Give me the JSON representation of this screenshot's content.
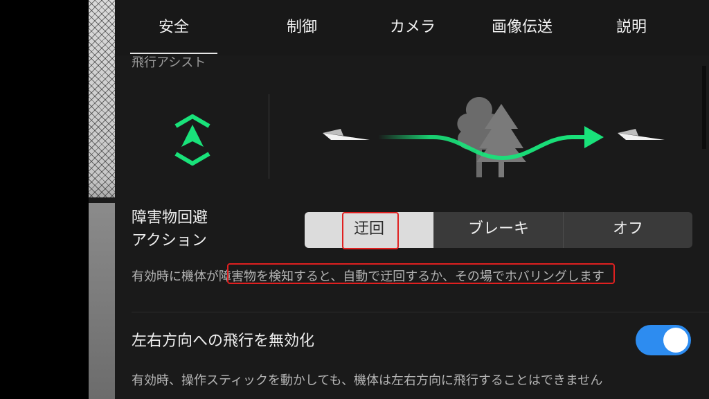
{
  "tabs": [
    {
      "label": "安全",
      "active": true
    },
    {
      "label": "制御",
      "active": false
    },
    {
      "label": "カメラ",
      "active": false
    },
    {
      "label": "画像伝送",
      "active": false
    },
    {
      "label": "説明",
      "active": false
    }
  ],
  "section_title": "飛行アシスト",
  "obstacle_avoidance": {
    "label_line1": "障害物回避",
    "label_line2": "アクション",
    "options": [
      {
        "label": "迂回",
        "selected": true
      },
      {
        "label": "ブレーキ",
        "selected": false
      },
      {
        "label": "オフ",
        "selected": false
      }
    ],
    "description": "有効時に機体が障害物を検知すると、自動で迂回するか、その場でホバリングします"
  },
  "lateral_flight": {
    "label": "左右方向への飛行を無効化",
    "enabled": true,
    "description": "有効時、操作スティックを動かしても、機体は左右方向に飛行することはできません"
  },
  "colors": {
    "accent_green": "#19e27a",
    "toggle_on": "#2d8cf0",
    "highlight_red": "#e02020"
  },
  "icons": {
    "mode_icon": "obstacle-avoid-mode-icon",
    "drone_icon": "paper-plane-icon",
    "tree_icon": "tree-icon",
    "arrow_icon": "detour-path-arrow-icon"
  }
}
